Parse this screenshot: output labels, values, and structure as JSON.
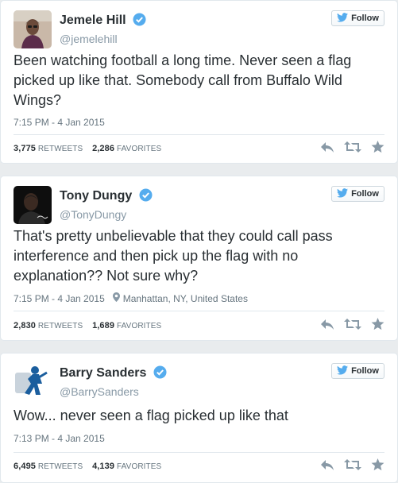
{
  "colors": {
    "twitter_blue": "#55acee",
    "verified_blue": "#55acee",
    "icon_gray": "#8899a6",
    "text": "#292f33",
    "secondary": "#66757f"
  },
  "follow_label": "Follow",
  "retweets_word": "RETWEETS",
  "favorites_word": "FAVORITES",
  "tweets": [
    {
      "name": "Jemele Hill",
      "handle": "@jemelehill",
      "text": "Been watching football a long time. Never seen a flag picked up like that. Somebody call from Buffalo Wild Wings?",
      "timestamp": "7:15 PM - 4 Jan 2015",
      "location": "",
      "retweets": "3,775",
      "favorites": "2,286"
    },
    {
      "name": "Tony Dungy",
      "handle": "@TonyDungy",
      "text": "That's pretty unbelievable that they could call pass interference and then pick up the flag with no explanation?? Not sure why?",
      "timestamp": "7:15 PM - 4 Jan 2015",
      "location": "Manhattan, NY, United States",
      "retweets": "2,830",
      "favorites": "1,689"
    },
    {
      "name": "Barry Sanders",
      "handle": "@BarrySanders",
      "text": "Wow... never seen a flag picked up like that",
      "timestamp": "7:13 PM - 4 Jan 2015",
      "location": "",
      "retweets": "6,495",
      "favorites": "4,139"
    }
  ]
}
